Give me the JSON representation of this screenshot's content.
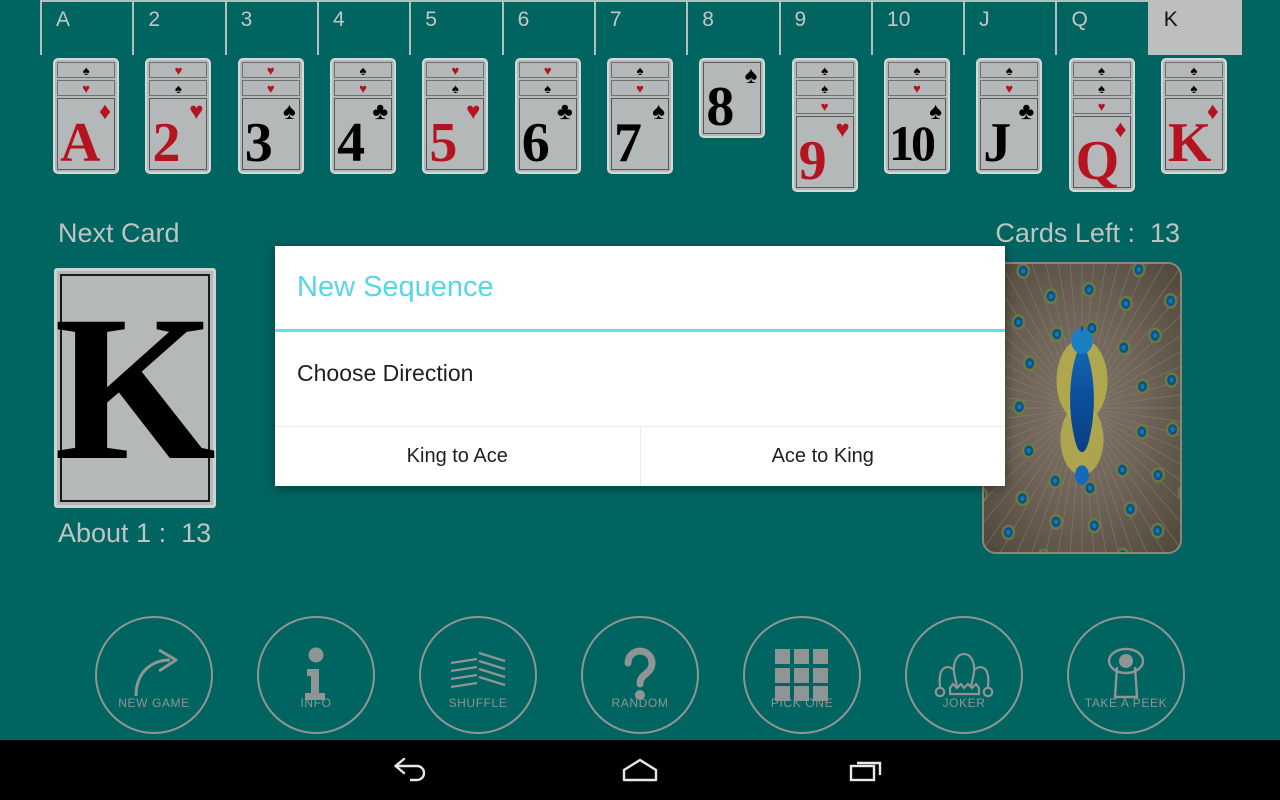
{
  "app": {
    "background_color": "#006460",
    "accent_color": "#56d7e4",
    "card_face_color": "#b5b8b8",
    "red_suit_color": "#b4131f"
  },
  "tabs": {
    "active": "K",
    "items": [
      {
        "label": "A",
        "active": false
      },
      {
        "label": "2",
        "active": false
      },
      {
        "label": "3",
        "active": false
      },
      {
        "label": "4",
        "active": false
      },
      {
        "label": "5",
        "active": false
      },
      {
        "label": "6",
        "active": false
      },
      {
        "label": "7",
        "active": false
      },
      {
        "label": "8",
        "active": false
      },
      {
        "label": "9",
        "active": false
      },
      {
        "label": "10",
        "active": false
      },
      {
        "label": "J",
        "active": false
      },
      {
        "label": "Q",
        "active": false
      },
      {
        "label": "K",
        "active": true
      }
    ]
  },
  "card_row": [
    {
      "rank": "A",
      "suit": "diamond",
      "color": "red",
      "back_pips": [
        {
          "suit": "spade",
          "color": "black"
        },
        {
          "suit": "heart",
          "color": "red"
        }
      ]
    },
    {
      "rank": "2",
      "suit": "heart",
      "color": "red",
      "back_pips": [
        {
          "suit": "heart",
          "color": "red"
        },
        {
          "suit": "spade",
          "color": "black"
        }
      ]
    },
    {
      "rank": "3",
      "suit": "spade",
      "color": "black",
      "back_pips": [
        {
          "suit": "heart",
          "color": "red"
        },
        {
          "suit": "heart",
          "color": "red"
        }
      ]
    },
    {
      "rank": "4",
      "suit": "club",
      "color": "black",
      "back_pips": [
        {
          "suit": "spade",
          "color": "black"
        },
        {
          "suit": "heart",
          "color": "red"
        }
      ]
    },
    {
      "rank": "5",
      "suit": "heart",
      "color": "red",
      "back_pips": [
        {
          "suit": "heart",
          "color": "red"
        },
        {
          "suit": "spade",
          "color": "black"
        }
      ]
    },
    {
      "rank": "6",
      "suit": "club",
      "color": "black",
      "back_pips": [
        {
          "suit": "heart",
          "color": "red"
        },
        {
          "suit": "spade",
          "color": "black"
        }
      ]
    },
    {
      "rank": "7",
      "suit": "spade",
      "color": "black",
      "back_pips": [
        {
          "suit": "spade",
          "color": "black"
        },
        {
          "suit": "heart",
          "color": "red"
        }
      ]
    },
    {
      "rank": "8",
      "suit": "spade",
      "color": "black",
      "back_pips": []
    },
    {
      "rank": "9",
      "suit": "heart",
      "color": "red",
      "back_pips": [
        {
          "suit": "spade",
          "color": "black"
        },
        {
          "suit": "spade",
          "color": "black"
        },
        {
          "suit": "heart",
          "color": "red"
        }
      ]
    },
    {
      "rank": "10",
      "suit": "spade",
      "color": "black",
      "back_pips": [
        {
          "suit": "spade",
          "color": "black"
        },
        {
          "suit": "heart",
          "color": "red"
        }
      ]
    },
    {
      "rank": "J",
      "suit": "club",
      "color": "black",
      "back_pips": [
        {
          "suit": "spade",
          "color": "black"
        },
        {
          "suit": "heart",
          "color": "red"
        }
      ]
    },
    {
      "rank": "Q",
      "suit": "diamond",
      "color": "red",
      "back_pips": [
        {
          "suit": "spade",
          "color": "black"
        },
        {
          "suit": "spade",
          "color": "black"
        },
        {
          "suit": "heart",
          "color": "red"
        }
      ]
    },
    {
      "rank": "K",
      "suit": "diamond",
      "color": "red",
      "back_pips": [
        {
          "suit": "spade",
          "color": "black"
        },
        {
          "suit": "spade",
          "color": "black"
        }
      ]
    }
  ],
  "status": {
    "next_card_label": "Next Card",
    "cards_left_label": "Cards Left :  13",
    "cards_left_count": 13,
    "about_label": "About 1 :  13",
    "about_ratio": "1 : 13",
    "next_card_rank": "K"
  },
  "toolbar": [
    {
      "label": "NEW GAME",
      "icon": "curved-arrow-icon"
    },
    {
      "label": "INFO",
      "icon": "info-icon"
    },
    {
      "label": "SHUFFLE",
      "icon": "riffle-cards-icon"
    },
    {
      "label": "RANDOM",
      "icon": "question-mark-icon"
    },
    {
      "label": "PICK ONE",
      "icon": "grid-icon"
    },
    {
      "label": "JOKER",
      "icon": "jester-hat-icon"
    },
    {
      "label": "TAKE A PEEK",
      "icon": "keyhole-icon"
    }
  ],
  "dialog": {
    "title": "New Sequence",
    "message": "Choose Direction",
    "buttons": [
      {
        "label": "King to Ace"
      },
      {
        "label": "Ace to King"
      }
    ]
  },
  "nav_bar": {
    "back": "back-icon",
    "home": "home-icon",
    "recents": "recents-icon"
  }
}
